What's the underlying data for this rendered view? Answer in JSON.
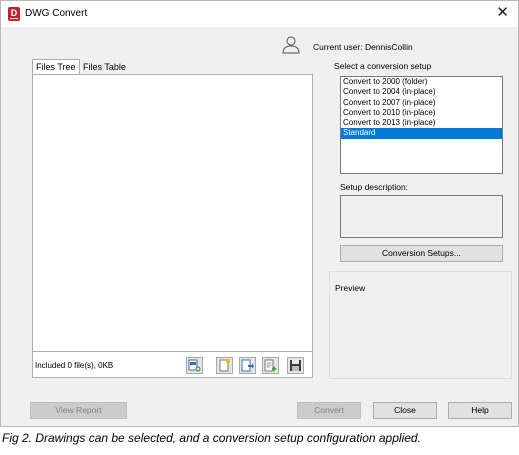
{
  "window": {
    "title": "DWG Convert",
    "app_icon_letter": "D"
  },
  "user": {
    "label": "Current user: DennisCollin"
  },
  "tabs": [
    {
      "label": "Files Tree",
      "active": true
    },
    {
      "label": "Files Table",
      "active": false
    }
  ],
  "files": {
    "status": "Included 0 file(s), 0KB"
  },
  "setup": {
    "label": "Select a conversion setup",
    "items": [
      {
        "label": "Convert to 2000 (folder)",
        "selected": false
      },
      {
        "label": "Convert to 2004 (in-place)",
        "selected": false
      },
      {
        "label": "Convert to 2007 (in-place)",
        "selected": false
      },
      {
        "label": "Convert to 2010 (in-place)",
        "selected": false
      },
      {
        "label": "Convert to 2013 (in-place)",
        "selected": false
      },
      {
        "label": "Standard",
        "selected": true
      }
    ],
    "description_label": "Setup description:",
    "setups_button": "Conversion Setups..."
  },
  "preview": {
    "label": "Preview"
  },
  "buttons": {
    "view_report": "View Report",
    "convert": "Convert",
    "close": "Close",
    "help": "Help"
  },
  "caption": "Fig 2. Drawings can be selected, and a conversion setup configuration applied.",
  "colors": {
    "selection": "#0078d7",
    "app_icon": "#c8202f"
  }
}
